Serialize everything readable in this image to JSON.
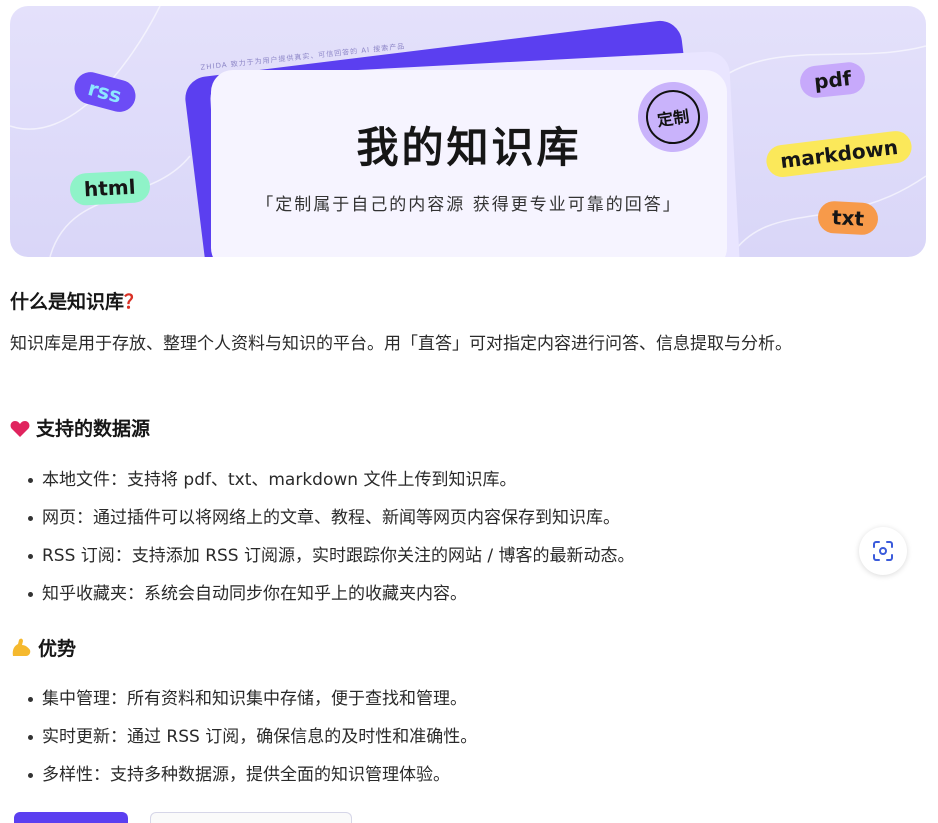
{
  "banner": {
    "tagline": "ZHIDA 致力于为用户提供真实、可信回答的 AI 搜索产品",
    "title": "我的知识库",
    "subtitle": "「定制属于自己的内容源  获得更专业可靠的回答」",
    "badge": "定制",
    "tags": {
      "rss": "rss",
      "html": "html",
      "pdf": "pdf",
      "markdown": "markdown",
      "txt": "txt"
    }
  },
  "what": {
    "heading": "什么是知识库",
    "heading_mark": "？",
    "body": "知识库是用于存放、整理个人资料与知识的平台。用「直答」可对指定内容进行问答、信息提取与分析。"
  },
  "sources": {
    "heading": "支持的数据源",
    "icon": "heart-icon",
    "items": [
      "本地文件：支持将 pdf、txt、markdown 文件上传到知识库。",
      "网页：通过插件可以将网络上的文章、教程、新闻等网页内容保存到知识库。",
      "RSS 订阅：支持添加 RSS 订阅源，实时跟踪你关注的网站 / 博客的最新动态。",
      "知乎收藏夹：系统会自动同步你在知乎上的收藏夹内容。"
    ]
  },
  "advantages": {
    "heading": "优势",
    "icon": "flexed-arm-icon",
    "items": [
      "集中管理：所有资料和知识集中存储，便于查找和管理。",
      "实时更新：通过 RSS 订阅，确保信息的及时性和准确性。",
      "多样性：支持多种数据源，提供全面的知识管理体验。"
    ]
  },
  "scan_button": {
    "icon": "scan-icon"
  },
  "colors": {
    "accent": "#5b3ff0",
    "banner_bg": "#dcd9f9",
    "heart": "#e0245e",
    "question": "#d93025"
  }
}
